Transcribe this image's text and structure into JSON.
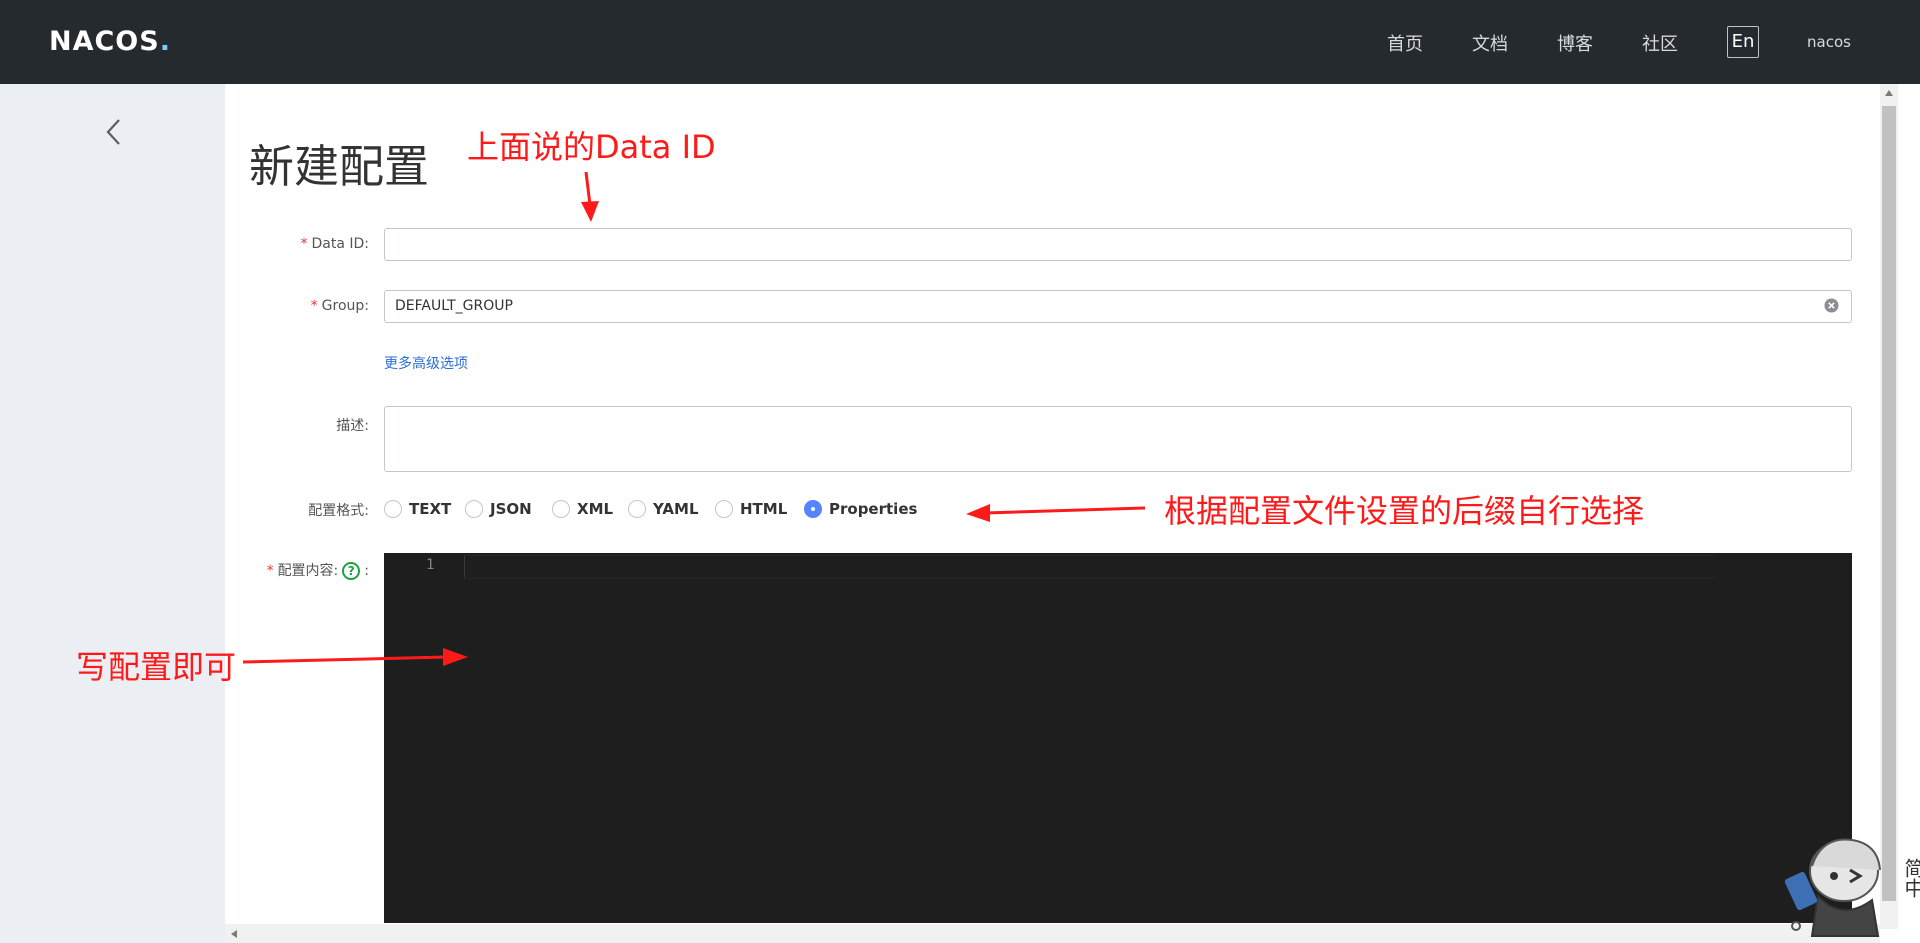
{
  "header": {
    "logo_text": "NACOS",
    "logo_dot": ".",
    "nav": [
      "首页",
      "文档",
      "博客",
      "社区"
    ],
    "lang_button": "En",
    "user": "nacos"
  },
  "page": {
    "title": "新建配置"
  },
  "form": {
    "data_id": {
      "required_mark": "*",
      "label": "Data ID:",
      "value": ""
    },
    "group": {
      "required_mark": "*",
      "label": "Group:",
      "value": "DEFAULT_GROUP"
    },
    "advanced_link": "更多高级选项",
    "description": {
      "label": "描述:",
      "value": ""
    },
    "format": {
      "label": "配置格式:",
      "options": [
        "TEXT",
        "JSON",
        "XML",
        "YAML",
        "HTML",
        "Properties"
      ],
      "selected": "Properties"
    },
    "content": {
      "required_mark": "*",
      "label": "配置内容:",
      "help_glyph": "?",
      "colon": ":",
      "line_number": "1"
    }
  },
  "annotations": {
    "data_id_note": "上面说的Data ID",
    "format_note": "根据配置文件设置的后缀自行选择",
    "content_note": "写配置即可"
  },
  "ime_indicator": "简中",
  "colors": {
    "topbar": "#252a2f",
    "sidebar": "#ebeef2",
    "accent": "#5584ff",
    "link": "#2a6fd6",
    "editor_bg": "#1e1e1e",
    "annotation": "#ff1a1a"
  }
}
